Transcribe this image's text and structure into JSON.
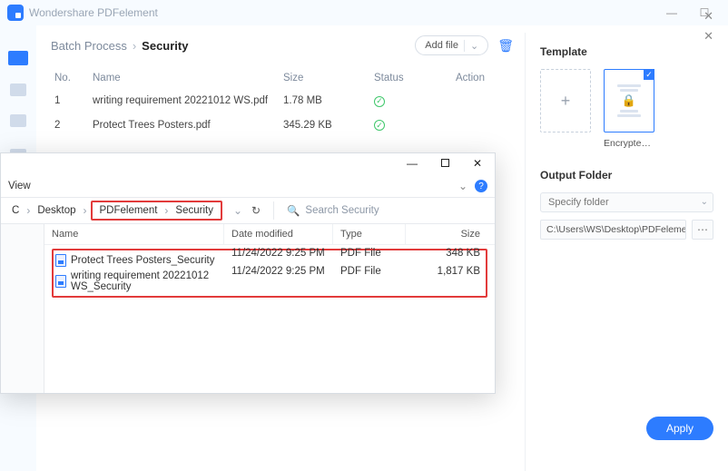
{
  "titlebar": {
    "title": "Wondershare PDFelement"
  },
  "crumb": {
    "section": "Batch Process",
    "page": "Security"
  },
  "toolbar": {
    "addfile": "Add file"
  },
  "table": {
    "headers": {
      "no": "No.",
      "name": "Name",
      "size": "Size",
      "status": "Status",
      "action": "Action"
    },
    "rows": [
      {
        "no": "1",
        "name": "writing requirement 20221012 WS.pdf",
        "size": "1.78 MB"
      },
      {
        "no": "2",
        "name": "Protect Trees Posters.pdf",
        "size": "345.29 KB"
      }
    ]
  },
  "template": {
    "heading": "Template",
    "selected_label": "Encrypted ..."
  },
  "output": {
    "heading": "Output Folder",
    "specify_placeholder": "Specify folder",
    "path": "C:\\Users\\WS\\Desktop\\PDFelement\\Sec"
  },
  "apply_label": "Apply",
  "explorer": {
    "view_label": "View",
    "path": {
      "root": "C",
      "p1": "Desktop",
      "p2": "PDFelement",
      "p3": "Security"
    },
    "search_placeholder": "Search Security",
    "headers": {
      "name": "Name",
      "dm": "Date modified",
      "type": "Type",
      "size": "Size"
    },
    "rows": [
      {
        "name": "Protect Trees Posters_Security",
        "dm": "11/24/2022 9:25 PM",
        "type": "PDF File",
        "size": "348 KB"
      },
      {
        "name": "writing requirement 20221012 WS_Security",
        "dm": "11/24/2022 9:25 PM",
        "type": "PDF File",
        "size": "1,817 KB"
      }
    ]
  }
}
